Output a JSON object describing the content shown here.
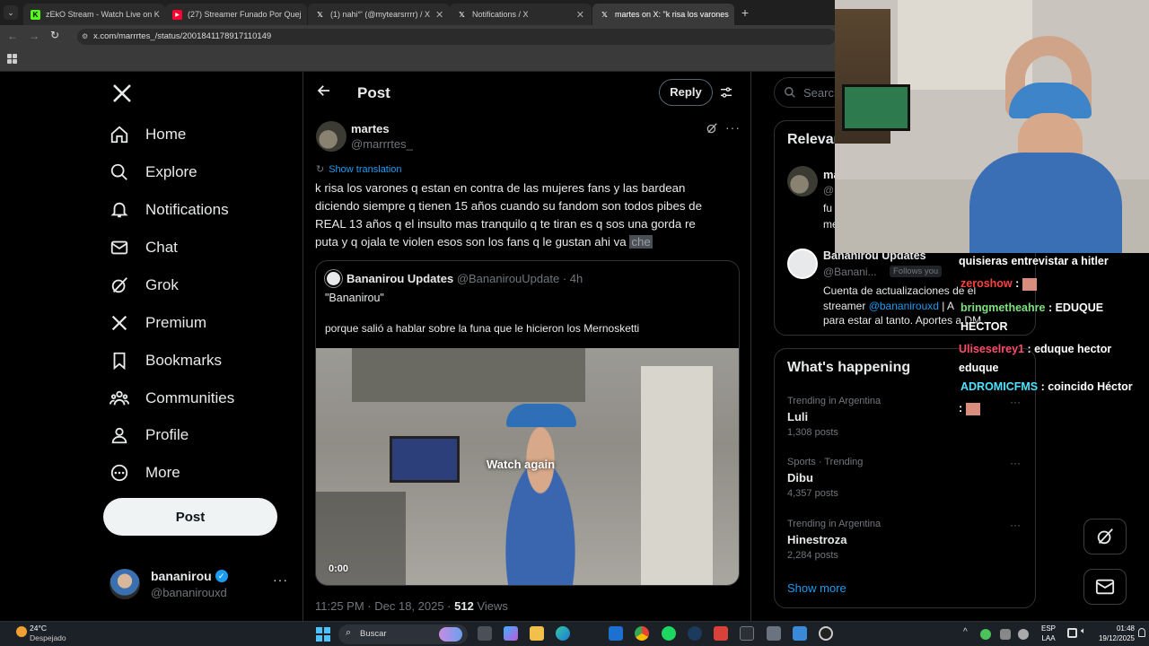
{
  "browser": {
    "tabs": [
      {
        "label": "zEkO Stream - Watch Live on K",
        "fav_color": "#53fc18",
        "fav_text": "K"
      },
      {
        "label": "(27) Streamer Funado Por Quej",
        "fav_color": "#ff0033",
        "fav_text": "▶"
      },
      {
        "label": "(1) nahi°' (@mytearsrrrr) / X",
        "fav_color": "#000000",
        "fav_text": "X"
      },
      {
        "label": "Notifications / X",
        "fav_color": "#000000",
        "fav_text": "X"
      },
      {
        "label": "martes on X: \"k risa los varones",
        "fav_color": "#000000",
        "fav_text": "X"
      }
    ],
    "url": "x.com/marrrtes_/status/2001841178917110149"
  },
  "nav": {
    "items": [
      {
        "label": "Home",
        "icon": "home-icon"
      },
      {
        "label": "Explore",
        "icon": "search-icon"
      },
      {
        "label": "Notifications",
        "icon": "bell-icon"
      },
      {
        "label": "Chat",
        "icon": "envelope-icon"
      },
      {
        "label": "Grok",
        "icon": "grok-icon"
      },
      {
        "label": "Premium",
        "icon": "x-logo-icon"
      },
      {
        "label": "Bookmarks",
        "icon": "bookmark-icon"
      },
      {
        "label": "Communities",
        "icon": "people-icon"
      },
      {
        "label": "Profile",
        "icon": "person-icon"
      },
      {
        "label": "More",
        "icon": "more-circle-icon"
      }
    ],
    "post_label": "Post",
    "account": {
      "name": "bananirou",
      "handle": "@bananirouxd"
    }
  },
  "post": {
    "header_title": "Post",
    "reply_label": "Reply",
    "author": {
      "name": "martes",
      "handle": "@marrrtes_"
    },
    "show_translation": "Show translation",
    "text_lines": [
      "k risa los varones q estan en contra de las mujeres fans y las bardean",
      "diciendo siempre q tienen 15 años cuando su fandom son todos pibes de",
      "REAL 13 años q el insulto mas tranquilo q te tiran es q sos una gorda re",
      "puta y q ojala te violen esos son los fans q le gustan ahi va"
    ],
    "highlighted_word": "che",
    "quote": {
      "name": "Bananirou Updates",
      "handle": "@BananirouUpdate",
      "time": "· 4h",
      "title": "\"Bananirou\"",
      "body": "porque salió a hablar sobre la funa que le hicieron los Mernosketti",
      "video_overlay": "Watch again",
      "video_time": "0:00"
    },
    "meta_time": "11:25 PM · Dec 18, 2025 ·",
    "views_count": "512",
    "views_label": "Views"
  },
  "right": {
    "search_placeholder": "Search",
    "relevant_title": "Relevant people",
    "relevant_people": [
      {
        "name": "ma",
        "handle": "@",
        "bio": "fu me"
      },
      {
        "name": "Bananirou Updates",
        "handle": "@Banani...",
        "follows_you": "Follows you",
        "bio_1": "Cuenta de actualizaciones de el",
        "bio_2a": "streamer ",
        "bio_mention": "@bananirouxd",
        "bio_2b": " | A",
        "bio_3": "para estar al tanto. Aportes a DM"
      }
    ],
    "happening_title": "What's happening",
    "trends": [
      {
        "context": "Trending in Argentina",
        "name": "Luli",
        "posts": "1,308 posts"
      },
      {
        "context": "Sports · Trending",
        "name": "Dibu",
        "posts": "4,357 posts"
      },
      {
        "context": "Trending in Argentina",
        "name": "Hinestroza",
        "posts": "2,284 posts"
      }
    ],
    "show_more": "Show more"
  },
  "stream_chat": {
    "messages": [
      {
        "user": "",
        "text": "quisieras entrevistar a hitler",
        "color": "#ffffff"
      },
      {
        "user": "zeroshow",
        "text": " : ",
        "color": "#ff4040"
      },
      {
        "user": "bringmetheahre",
        "text": " : EDUQUE HECTOR",
        "color": "#7fe27f"
      },
      {
        "user": "Uliseselrey1",
        "text": " : eduque hector eduque",
        "color": "#ff4d6a"
      },
      {
        "user": "ADROMICFMS",
        "text": " : coincido Héctor",
        "color": "#4fe3ff"
      },
      {
        "user": "",
        "text": ":",
        "color": "#ffffff"
      }
    ]
  },
  "taskbar": {
    "weather_temp": "24°C",
    "weather_desc": "Despejado",
    "search_label": "Buscar",
    "lang_top": "ESP",
    "lang_bottom": "LAA",
    "time": "01:48",
    "date": "19/12/2025"
  }
}
